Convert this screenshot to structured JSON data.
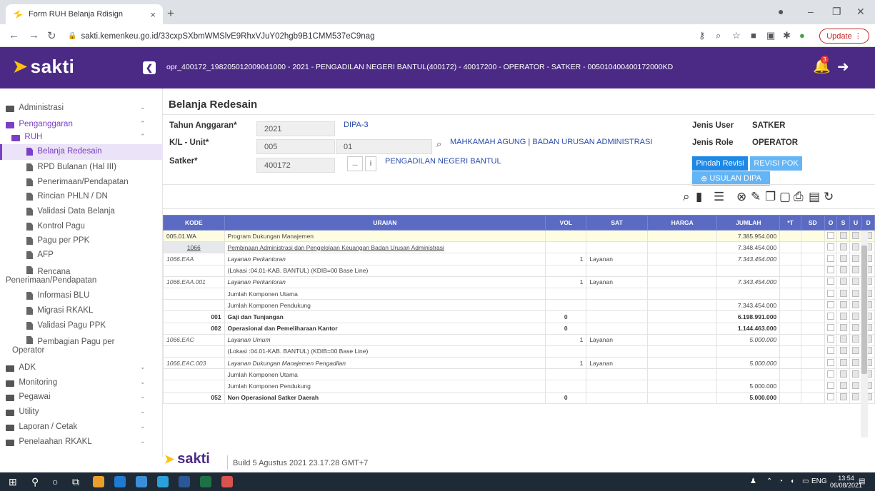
{
  "browser": {
    "tab_title": "Form RUH Belanja Rdisign",
    "url": "sakti.kemenkeu.go.id/33cxpSXbmWMSlvE9RhxVJuY02hgb9B1CMM537eC9nag",
    "update_label": "Update"
  },
  "header": {
    "logo": "sakti",
    "user_info": "opr_400172_198205012009041000 - 2021 - PENGADILAN NEGERI BANTUL(400172) - 40017200 - OPERATOR - SATKER - 005010400400172000KD",
    "notif_count": "3"
  },
  "sidebar": {
    "items": [
      {
        "label": "Administrasi"
      },
      {
        "label": "Penganggaran"
      },
      {
        "label": "RUH"
      },
      {
        "label": "Belanja Redesain"
      },
      {
        "label": "RPD Bulanan (Hal III)"
      },
      {
        "label": "Penerimaan/Pendapatan"
      },
      {
        "label": "Rincian PHLN / DN"
      },
      {
        "label": "Validasi Data Belanja"
      },
      {
        "label": "Kontrol Pagu"
      },
      {
        "label": "Pagu per PPK"
      },
      {
        "label": "AFP"
      },
      {
        "label": "Rencana",
        "label2": "Penerimaan/Pendapatan"
      },
      {
        "label": "Informasi BLU"
      },
      {
        "label": "Migrasi RKAKL"
      },
      {
        "label": "Validasi Pagu PPK"
      },
      {
        "label": "Pembagian Pagu per",
        "label2": "Operator"
      },
      {
        "label": "ADK"
      },
      {
        "label": "Monitoring"
      },
      {
        "label": "Pegawai"
      },
      {
        "label": "Utility"
      },
      {
        "label": "Laporan / Cetak"
      },
      {
        "label": "Penelaahan RKAKL"
      }
    ]
  },
  "form": {
    "title": "Belanja Redesain",
    "tahun_label": "Tahun Anggaran*",
    "tahun_value": "2021",
    "dipa": "DIPA-3",
    "kl_label": "K/L - Unit*",
    "kl_value1": "005",
    "kl_value2": "01",
    "kl_name": "MAHKAMAH AGUNG | BADAN URUSAN ADMINISTRASI",
    "satker_label": "Satker*",
    "satker_value": "400172",
    "satker_name": "PENGADILAN NEGERI BANTUL",
    "jenis_user_label": "Jenis User",
    "jenis_user_value": "SATKER",
    "jenis_role_label": "Jenis Role",
    "jenis_role_value": "OPERATOR",
    "btn_pindah": "Pindah Revisi",
    "btn_revisi": "REVISI POK",
    "btn_usulan": "USULAN DIPA",
    "btn_dots": "...",
    "btn_info": "i"
  },
  "table": {
    "columns": [
      "KODE",
      "URAIAN",
      "VOL",
      "SAT",
      "HARGA",
      "JUMLAH",
      "*T",
      "SD",
      "O",
      "S",
      "U",
      "D"
    ],
    "rows": [
      {
        "kode": "005.01.WA",
        "uraian": "Program Dukungan Manajemen",
        "vol": "",
        "sat": "",
        "jumlah": "7.385.954.000",
        "style": "hl",
        "kstyle": "kodegrey",
        "ustyle": "",
        "jstyle": "num"
      },
      {
        "kode": "1066",
        "uraian": "Pembinaan Administrasi dan Pengelolaan Keuangan Badan Urusan Administrasi",
        "vol": "",
        "sat": "",
        "jumlah": "7.348.454.000",
        "style": "",
        "kstyle": "kodemid",
        "ustyle": "ur-under",
        "jstyle": "num"
      },
      {
        "kode": "1066.EAA",
        "uraian": "Layanan Perkantoran",
        "vol": "1",
        "sat": "Layanan",
        "jumlah": "7.343.454.000",
        "style": "",
        "kstyle": "kode",
        "ustyle": "ur-italic",
        "jstyle": "numi"
      },
      {
        "kode": "",
        "uraian": "(Lokasi :04.01-KAB. BANTUL) (KDIB=00 Base Line)",
        "vol": "",
        "sat": "",
        "jumlah": "",
        "style": "",
        "kstyle": "kode",
        "ustyle": "",
        "jstyle": "num"
      },
      {
        "kode": "1066.EAA.001",
        "uraian": "Layanan Perkantoran",
        "vol": "1",
        "sat": "Layanan",
        "jumlah": "7.343.454.000",
        "style": "",
        "kstyle": "kode",
        "ustyle": "ur-italic",
        "jstyle": "numi"
      },
      {
        "kode": "",
        "uraian": "Jumlah Komponen Utama",
        "vol": "",
        "sat": "",
        "jumlah": "",
        "style": "",
        "kstyle": "kode",
        "ustyle": "",
        "jstyle": "num"
      },
      {
        "kode": "",
        "uraian": "Jumlah Komponen Pendukung",
        "vol": "",
        "sat": "",
        "jumlah": "7.343.454.000",
        "style": "",
        "kstyle": "kode",
        "ustyle": "",
        "jstyle": "num"
      },
      {
        "kode": "001",
        "uraian": "Gaji dan Tunjangan",
        "vol": "0",
        "sat": "",
        "jumlah": "6.198.991.000",
        "style": "",
        "kstyle": "kodebold",
        "ustyle": "ur-bold",
        "jstyle": "numb"
      },
      {
        "kode": "002",
        "uraian": "Operasional dan Pemeliharaan Kantor",
        "vol": "0",
        "sat": "",
        "jumlah": "1.144.463.000",
        "style": "",
        "kstyle": "kodebold",
        "ustyle": "ur-bold",
        "jstyle": "numb"
      },
      {
        "kode": "1066.EAC",
        "uraian": "Layanan Umum",
        "vol": "1",
        "sat": "Layanan",
        "jumlah": "5.000.000",
        "style": "",
        "kstyle": "kode",
        "ustyle": "ur-italic",
        "jstyle": "numi"
      },
      {
        "kode": "",
        "uraian": "(Lokasi :04.01-KAB. BANTUL) (KDIB=00 Base Line)",
        "vol": "",
        "sat": "",
        "jumlah": "",
        "style": "",
        "kstyle": "kode",
        "ustyle": "",
        "jstyle": "num"
      },
      {
        "kode": "1066.EAC.003",
        "uraian": "Layanan Dukungan Manajemen Pengadilan",
        "vol": "1",
        "sat": "Layanan",
        "jumlah": "5.000.000",
        "style": "",
        "kstyle": "kode",
        "ustyle": "ur-italic",
        "jstyle": "numi"
      },
      {
        "kode": "",
        "uraian": "Jumlah Komponen Utama",
        "vol": "",
        "sat": "",
        "jumlah": "",
        "style": "",
        "kstyle": "kode",
        "ustyle": "",
        "jstyle": "num"
      },
      {
        "kode": "",
        "uraian": "Jumlah Komponen Pendukung",
        "vol": "",
        "sat": "",
        "jumlah": "5.000.000",
        "style": "",
        "kstyle": "kode",
        "ustyle": "",
        "jstyle": "num"
      },
      {
        "kode": "052",
        "uraian": "Non Operasional Satker Daerah",
        "vol": "0",
        "sat": "",
        "jumlah": "5.000.000",
        "style": "",
        "kstyle": "kodebold",
        "ustyle": "ur-bold",
        "jstyle": "numb"
      }
    ]
  },
  "footer": {
    "logo": "sakti",
    "build": "Build 5 Agustus 2021 23.17.28 GMT+7"
  },
  "taskbar": {
    "lang": "ENG",
    "time": "13:54",
    "date": "06/08/2021"
  },
  "colors": {
    "header_bg": "#4b2a86",
    "table_header": "#5b6bc4",
    "accent_purple": "#7b3fc4",
    "button_blue": "#1e88e5"
  }
}
